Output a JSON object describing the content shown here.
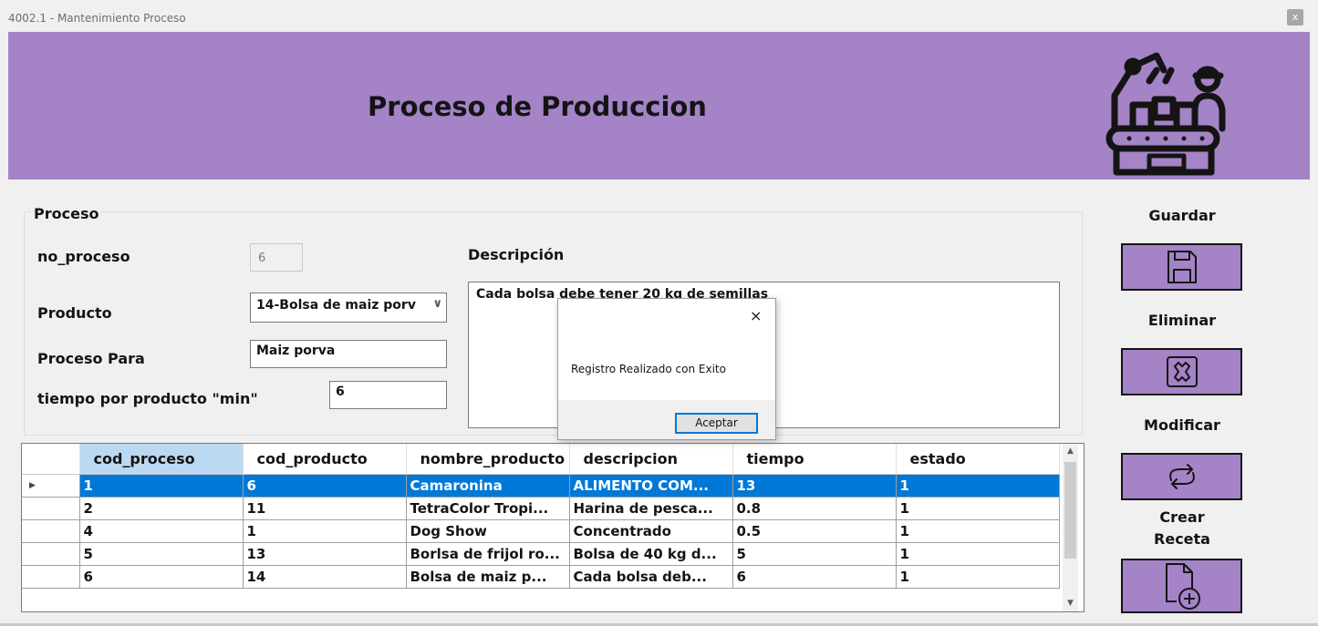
{
  "window": {
    "title": "4002.1 - Mantenimiento Proceso",
    "close_label": "x"
  },
  "header": {
    "title": "Proceso de Produccion",
    "icon": "factory-worker-conveyor-icon"
  },
  "form": {
    "group_title": "Proceso",
    "no_proceso_label": "no_proceso",
    "no_proceso_value": "6",
    "producto_label": "Producto",
    "producto_value": "14-Bolsa de maiz porv",
    "proceso_para_label": "Proceso Para",
    "proceso_para_value": "Maiz porva",
    "tiempo_label": "tiempo por producto \"min\"",
    "tiempo_value": "6",
    "descripcion_label": "Descripción",
    "descripcion_value": "Cada bolsa debe tener 20 kg de semillas"
  },
  "actions": {
    "guardar": "Guardar",
    "eliminar": "Eliminar",
    "modificar": "Modificar",
    "crear_receta_line1": "Crear",
    "crear_receta_line2": "Receta"
  },
  "grid": {
    "columns": [
      "cod_proceso",
      "cod_producto",
      "nombre_producto",
      "descripcion",
      "tiempo",
      "estado"
    ],
    "rows": [
      [
        "1",
        "6",
        "Camaronina",
        "ALIMENTO COM...",
        "13",
        "1"
      ],
      [
        "2",
        "11",
        "TetraColor Tropi...",
        "Harina de pesca...",
        "0.8",
        "1"
      ],
      [
        "4",
        "1",
        "Dog Show",
        "Concentrado",
        "0.5",
        "1"
      ],
      [
        "5",
        "13",
        "Borlsa de frijol ro...",
        "Bolsa de 40 kg d...",
        "5",
        "1"
      ],
      [
        "6",
        "14",
        "Bolsa de maiz p...",
        "Cada bolsa deb...",
        "6",
        "1"
      ]
    ],
    "selected_row": 0,
    "row_indicator": "▶"
  },
  "dialog": {
    "message": "Registro Realizado con Exito",
    "ok_label": "Aceptar",
    "close_label": "×"
  },
  "colors": {
    "header_bg": "#a483c6",
    "selection": "#0078d7",
    "col_header_selected": "#bcd9f2"
  }
}
